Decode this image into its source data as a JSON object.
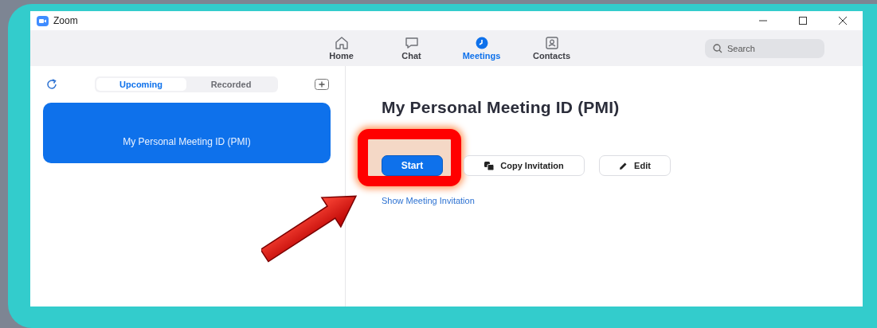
{
  "window": {
    "title": "Zoom"
  },
  "nav_tabs": [
    {
      "label": "Home",
      "kind": "home",
      "selected": false
    },
    {
      "label": "Chat",
      "kind": "chat",
      "selected": false
    },
    {
      "label": "Meetings",
      "kind": "meetings",
      "selected": true
    },
    {
      "label": "Contacts",
      "kind": "contacts",
      "selected": false
    }
  ],
  "search": {
    "placeholder": "Search"
  },
  "list_tabs": [
    {
      "label": "Upcoming",
      "selected": true
    },
    {
      "label": "Recorded",
      "selected": false
    }
  ],
  "meetings": [
    {
      "title": "My Personal Meeting ID (PMI)",
      "selected": true
    }
  ],
  "detail": {
    "title": "My Personal Meeting ID (PMI)",
    "buttons": [
      {
        "label": "Start",
        "kind": "primary",
        "highlighted": true
      },
      {
        "label": "Copy Invitation",
        "kind": "copy",
        "highlighted": false
      },
      {
        "label": "Edit",
        "kind": "edit",
        "highlighted": false
      }
    ],
    "link": "Show Meeting Invitation"
  }
}
